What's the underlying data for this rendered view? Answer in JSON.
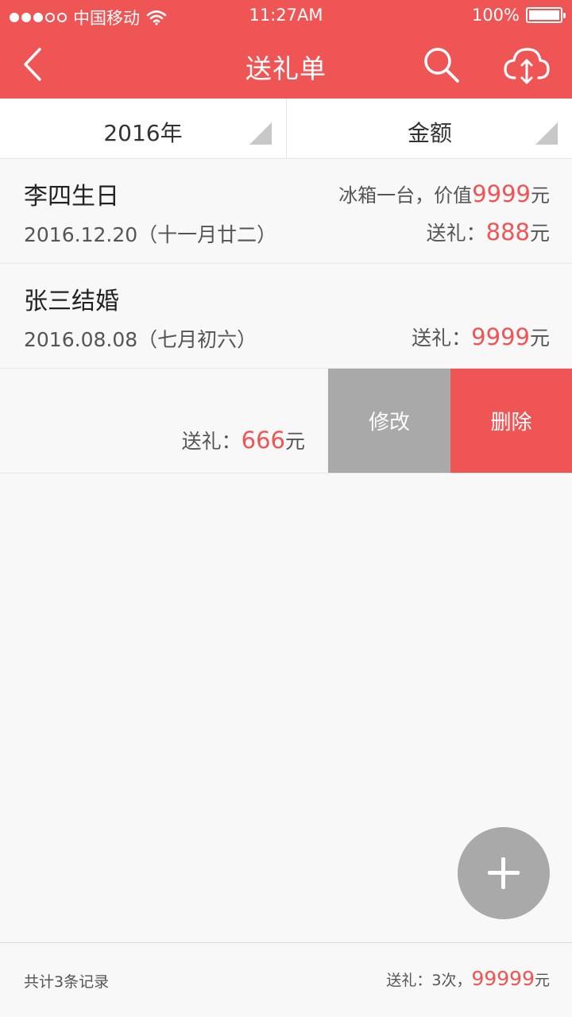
{
  "status": {
    "carrier": "中国移动",
    "time": "11:27AM",
    "battery": "100%",
    "signal_icon": "signal-dots-icon",
    "wifi_icon": "wifi-icon"
  },
  "nav": {
    "title": "送礼单",
    "back_icon": "back-chevron-icon",
    "search_icon": "search-icon",
    "cloud_icon": "cloud-sync-icon"
  },
  "filters": {
    "year": "2016年",
    "sort": "金额"
  },
  "records": [
    {
      "name": "李四生日",
      "date": "2016.12.20（十一月廿二）",
      "desc_prefix": "冰箱一台，价值",
      "desc_value": "9999",
      "desc_unit": "元",
      "gift_label": "送礼：",
      "gift_value": "888",
      "gift_unit": "元"
    },
    {
      "name": "张三结婚",
      "date": "2016.08.08（七月初六）",
      "gift_label": "送礼：",
      "gift_value": "9999",
      "gift_unit": "元"
    },
    {
      "gift_label": "送礼：",
      "gift_value": "666",
      "gift_unit": "元",
      "edit_label": "修改",
      "delete_label": "删除"
    }
  ],
  "footer": {
    "count_text": "共计3条记录",
    "summary_prefix": "送礼：3次，",
    "summary_value": "99999",
    "summary_unit": "元"
  },
  "colors": {
    "accent": "#f05556",
    "gray_button": "#a9a9a9",
    "background": "#f8f8f8"
  }
}
